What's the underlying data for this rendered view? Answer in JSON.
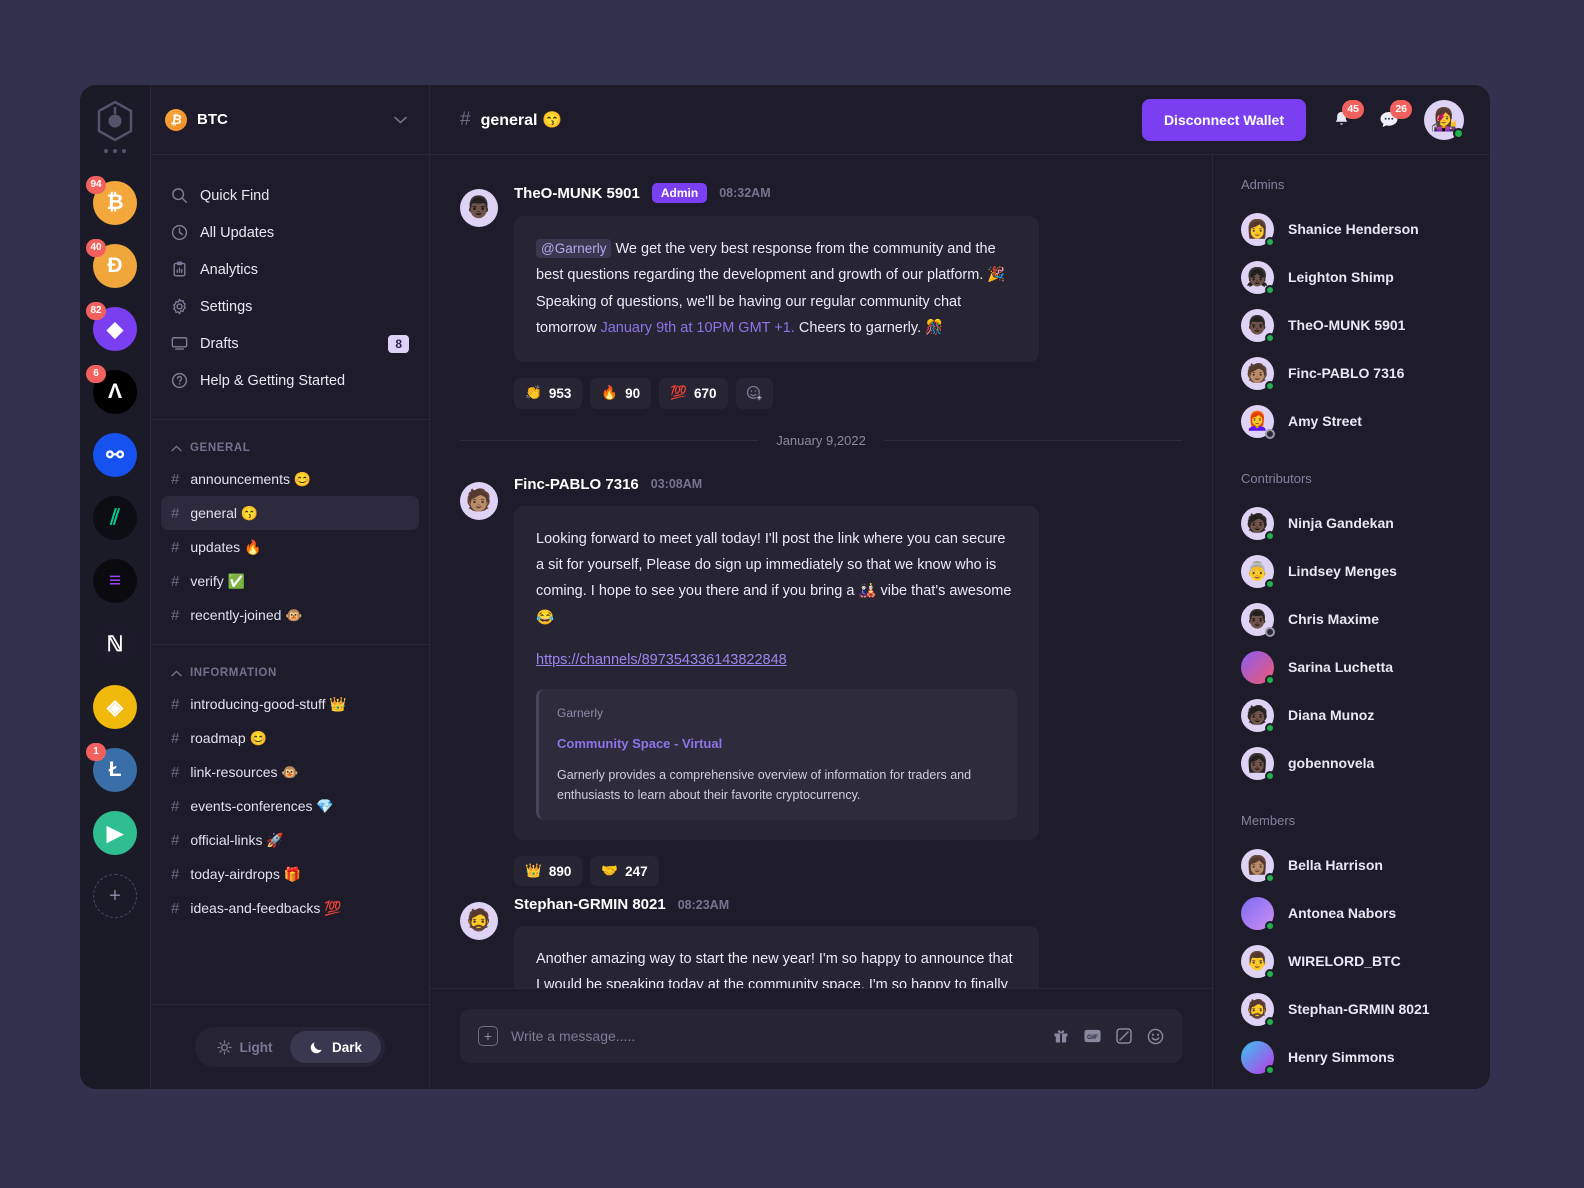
{
  "colors": {
    "page_bg": "#32324e",
    "window_bg": "#1b1a27",
    "panel_bg": "#1e1c2b",
    "bubble_bg": "#272434",
    "accent_purple": "#7b3ff2",
    "badge_red": "#f2615e",
    "online_green": "#21b14b",
    "link_purple": "#9b86ee"
  },
  "rail": {
    "logo_icon": "hexagon-logo-icon",
    "more_icon": "more-dots-icon",
    "servers": [
      {
        "name": "bitcoin",
        "symbol": "₿",
        "badge": "94",
        "bg": "#f4a83c",
        "fg": "#ffffff"
      },
      {
        "name": "dogecoin",
        "symbol": "Ð",
        "badge": "40",
        "bg": "#f0a63a",
        "fg": "#ffffff"
      },
      {
        "name": "ethereum",
        "symbol": "◆",
        "badge": "82",
        "bg": "#7b3ff2",
        "fg": "#ffffff"
      },
      {
        "name": "algorand",
        "symbol": "Λ",
        "badge": "6",
        "bg": "#000000",
        "fg": "#ffffff"
      },
      {
        "name": "ocean-protocol",
        "symbol": "⚯",
        "badge": "",
        "bg": "#1652f0",
        "fg": "#ffffff"
      },
      {
        "name": "compound",
        "symbol": "⫽",
        "badge": "",
        "bg": "#0d0d14",
        "fg": "#00d395"
      },
      {
        "name": "solana",
        "symbol": "≡",
        "badge": "",
        "bg": "#0b0b0f",
        "fg": "#9945ff"
      },
      {
        "name": "near-protocol",
        "symbol": "ℕ",
        "badge": "",
        "bg": "#1d1b29",
        "fg": "#ffffff"
      },
      {
        "name": "binance",
        "symbol": "◈",
        "badge": "",
        "bg": "#f0b90b",
        "fg": "#ffffff"
      },
      {
        "name": "litecoin",
        "symbol": "Ł",
        "badge": "1",
        "bg": "#3a6ea8",
        "fg": "#ffffff"
      },
      {
        "name": "polygon",
        "symbol": "▶",
        "badge": "",
        "bg": "#2fbe8f",
        "fg": "#ffffff"
      }
    ],
    "add_server_label": "+"
  },
  "sidebar": {
    "workspace": {
      "name": "BTC",
      "coin_symbol": "₿",
      "chevron_icon": "chevron-down-icon"
    },
    "nav": [
      {
        "label": "Quick Find",
        "icon": "search-icon",
        "badge": ""
      },
      {
        "label": "All Updates",
        "icon": "clock-icon",
        "badge": ""
      },
      {
        "label": "Analytics",
        "icon": "analytics-icon",
        "badge": ""
      },
      {
        "label": "Settings",
        "icon": "gear-icon",
        "badge": ""
      },
      {
        "label": "Drafts",
        "icon": "drafts-icon",
        "badge": "8"
      },
      {
        "label": "Help & Getting Started",
        "icon": "help-icon",
        "badge": ""
      }
    ],
    "sections": [
      {
        "title": "GENERAL",
        "channels": [
          {
            "label": "announcements 😊",
            "active": false
          },
          {
            "label": "general 😙",
            "active": true
          },
          {
            "label": "updates 🔥",
            "active": false
          },
          {
            "label": "verify ✅",
            "active": false
          },
          {
            "label": "recently-joined 🐵",
            "active": false
          }
        ]
      },
      {
        "title": "INFORMATION",
        "channels": [
          {
            "label": "introducing-good-stuff 👑",
            "active": false
          },
          {
            "label": "roadmap 😊",
            "active": false
          },
          {
            "label": "link-resources 🐵",
            "active": false
          },
          {
            "label": "events-conferences 💎",
            "active": false
          },
          {
            "label": "official-links 🚀",
            "active": false
          },
          {
            "label": "today-airdrops 🎁",
            "active": false
          },
          {
            "label": "ideas-and-feedbacks 💯",
            "active": false
          }
        ]
      }
    ],
    "theme": {
      "light_label": "Light",
      "dark_label": "Dark",
      "selected": "Dark"
    }
  },
  "header": {
    "channel_hash": "#",
    "channel_name": "general 😙",
    "wallet_button": "Disconnect Wallet",
    "notifications": {
      "icon": "bell-icon",
      "count": "45"
    },
    "messages": {
      "icon": "chat-bubble-icon",
      "count": "26"
    },
    "avatar_emoji": "👩‍🎤"
  },
  "messages": [
    {
      "author": "TheO-MUNK 5901",
      "avatar_emoji": "👨🏿",
      "role_badge": "Admin",
      "time": "08:32AM",
      "mention": "@Garnerly",
      "text_1": " We get the very best response from the community and the best questions regarding the development and growth of our platform. 🎉 Speaking of questions, we'll be having our regular community chat tomorrow ",
      "highlight": "January 9th at 10PM GMT +1.",
      "text_2": " Cheers to garnerly. 🎊",
      "reactions": [
        {
          "emoji": "👏",
          "count": "953"
        },
        {
          "emoji": "🔥",
          "count": "90"
        },
        {
          "emoji": "💯",
          "count": "670"
        }
      ],
      "add_reaction_icon": "add-reaction-icon"
    },
    {
      "author": "Finc-PABLO 7316",
      "avatar_emoji": "🧑🏽",
      "role_badge": "",
      "time": "03:08AM",
      "text_1": "Looking forward to meet yall today! I'll post the link where you can secure a sit for yourself, Please do sign up immediately so that we know who is coming. I hope to see you there and if you bring a 🎎 vibe that's awesome 😂",
      "link": "https://channels/897354336143822848",
      "embed": {
        "site": "Garnerly",
        "title": "Community Space - Virtual",
        "description": "Garnerly provides a comprehensive overview of information for traders and enthusiasts to learn about their favorite cryptocurrency."
      },
      "reactions": [
        {
          "emoji": "👑",
          "count": "890"
        },
        {
          "emoji": "🤝",
          "count": "247"
        }
      ]
    },
    {
      "author": "Stephan-GRMIN 8021",
      "avatar_emoji": "🧔",
      "role_badge": "",
      "time": "08:23AM",
      "text_1": "Another amazing way to start the new year! I'm so happy to announce that I would be speaking today at the community space. I'm so happy to finally be on this! Looking forward to meet yall. 😛 😃",
      "reactions": []
    }
  ],
  "date_divider": "January 9,2022",
  "composer": {
    "plus_icon": "plus-icon",
    "placeholder": "Write a message.....",
    "icons": [
      "gift-icon",
      "gif-icon",
      "sticker-icon",
      "emoji-icon"
    ]
  },
  "members": {
    "groups": [
      {
        "title": "Admins",
        "people": [
          {
            "name": "Shanice Henderson",
            "emoji": "👩",
            "status": "online",
            "bg": "#dfd3f5"
          },
          {
            "name": "Leighton Shimp",
            "emoji": "👧🏿",
            "status": "online",
            "bg": "#dfd3f5"
          },
          {
            "name": "TheO-MUNK 5901",
            "emoji": "👨🏿",
            "status": "online",
            "bg": "#dfd3f5"
          },
          {
            "name": "Finc-PABLO 7316",
            "emoji": "🧑🏽",
            "status": "online",
            "bg": "#dfd3f5"
          },
          {
            "name": "Amy Street",
            "emoji": "👩‍🦰",
            "status": "offline",
            "bg": "#dfd3f5"
          }
        ]
      },
      {
        "title": "Contributors",
        "people": [
          {
            "name": "Ninja Gandekan",
            "emoji": "🧑🏿",
            "status": "online",
            "bg": "#dfd3f5"
          },
          {
            "name": "Lindsey Menges",
            "emoji": "👵",
            "status": "online",
            "bg": "#dfd3f5"
          },
          {
            "name": "Chris Maxime",
            "emoji": "👨🏿",
            "status": "offline",
            "bg": "#dfd3f5"
          },
          {
            "name": "Sarina Luchetta",
            "emoji": "",
            "status": "online",
            "bg": "linear-gradient(135deg,#8a5cf6,#f0596f)"
          },
          {
            "name": "Diana Munoz",
            "emoji": "🧑🏿",
            "status": "online",
            "bg": "#dfd3f5"
          },
          {
            "name": "gobennovela",
            "emoji": "👩🏿",
            "status": "online",
            "bg": "#dfd3f5"
          }
        ]
      },
      {
        "title": "Members",
        "people": [
          {
            "name": "Bella Harrison",
            "emoji": "👩🏽",
            "status": "online",
            "bg": "#dfd3f5"
          },
          {
            "name": "Antonea Nabors",
            "emoji": "",
            "status": "online",
            "bg": "linear-gradient(135deg,#7b6cf6,#d08ef0)"
          },
          {
            "name": "WIRELORD_BTC",
            "emoji": "👨",
            "status": "online",
            "bg": "#dfd3f5"
          },
          {
            "name": "Stephan-GRMIN 8021",
            "emoji": "🧔",
            "status": "online",
            "bg": "#dfd3f5"
          },
          {
            "name": "Henry Simmons",
            "emoji": "",
            "status": "online",
            "bg": "linear-gradient(135deg,#36c5f0,#c038e8)"
          }
        ]
      }
    ]
  }
}
